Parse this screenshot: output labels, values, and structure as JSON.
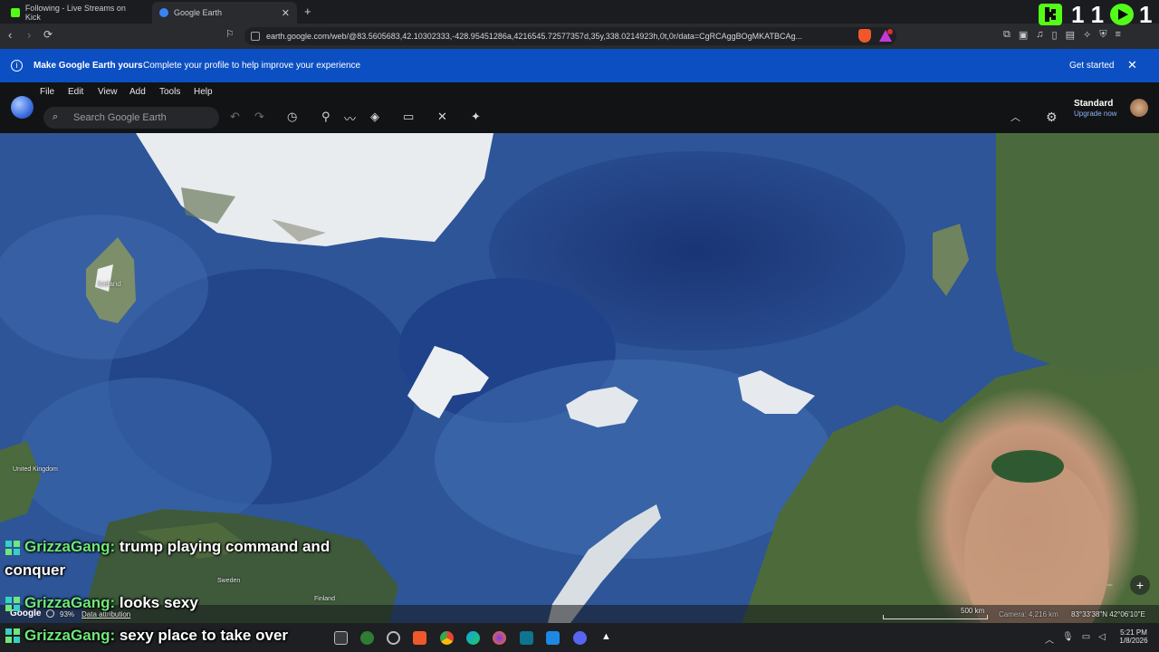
{
  "browser": {
    "tabs": [
      {
        "label": "Following - Live Streams on Kick",
        "favicon": "kick-icon",
        "active": false
      },
      {
        "label": "Google Earth",
        "favicon": "google-earth-icon",
        "active": true
      }
    ],
    "url": "earth.google.com/web/@83.5605683,42.10302333,-428.95451286a,4216545.72577357d,35y,338.0214923h,0t,0r/data=CgRCAggBOgMKATBCAg..."
  },
  "banner": {
    "title": "Make Google Earth yours",
    "message": "Complete your profile to help improve your experience",
    "cta": "Get started"
  },
  "menu": {
    "items": [
      "File",
      "Edit",
      "View",
      "Add",
      "Tools",
      "Help"
    ]
  },
  "search": {
    "placeholder": "Search Google Earth"
  },
  "account": {
    "plan": "Standard",
    "upgrade": "Upgrade now"
  },
  "overlay": {
    "counter": "1 1",
    "counter2": "1",
    "chat": [
      {
        "user": "GrizzaGang:",
        "text": " trump playing command and",
        "cont": "conquer"
      },
      {
        "user": "GrizzaGang:",
        "text": " looks sexy"
      },
      {
        "user": "GrizzaGang:",
        "text": " sexy place to take over"
      }
    ]
  },
  "map": {
    "labels": {
      "iceland": "Iceland",
      "uk": "United Kingdom",
      "sweden": "Sweden",
      "finland": "Finland"
    },
    "google_logo": "Google",
    "loading": "93%",
    "attribution": "Data attribution",
    "scale": "500 km",
    "camera": "Camera: 4,216 km",
    "coords": "83°33'38\"N 42°06'10\"E"
  },
  "taskbar": {
    "time": "5:21 PM",
    "date": "1/8/2026"
  },
  "colors": {
    "banner": "#0c4fc2",
    "ocean": "#2a4f93",
    "deep_ocean": "#1d3a7a",
    "kick_green": "#53fc18"
  }
}
